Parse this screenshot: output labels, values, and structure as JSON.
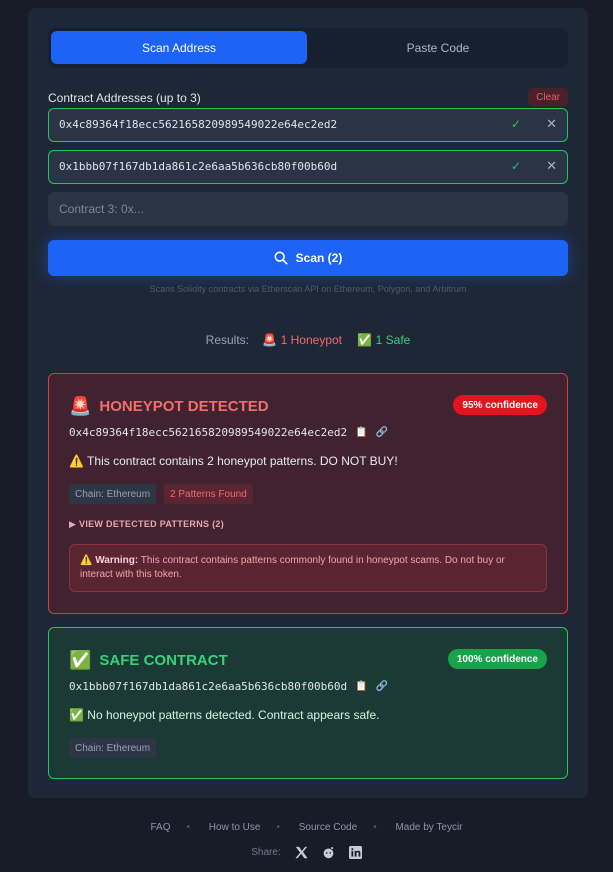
{
  "tabs": {
    "scan_address": "Scan Address",
    "paste_code": "Paste Code"
  },
  "form": {
    "label": "Contract Addresses (up to 3)",
    "clear": "Clear",
    "address_1": "0x4c89364f18ecc562165820989549022e64ec2ed2",
    "address_2": "0x1bbb07f167db1da861c2e6aa5b636cb80f00b60d",
    "address_3_placeholder": "Contract 3: 0x...",
    "scan_label": "Scan (2)",
    "hint": "Scans Solidity contracts via Etherscan API on Ethereum, Polygon, and Arbitrum"
  },
  "results": {
    "label": "Results:",
    "honeypot": "🚨 1 Honeypot",
    "safe": "✅ 1 Safe"
  },
  "cards": {
    "honeypot": {
      "title": "HONEYPOT DETECTED",
      "confidence": "95% confidence",
      "address": "0x4c89364f18ecc562165820989549022e64ec2ed2",
      "message": "⚠️ This contract contains 2 honeypot patterns. DO NOT BUY!",
      "chain": "Chain: Ethereum",
      "patterns_found": "2 Patterns Found",
      "view_patterns": "▶  VIEW DETECTED PATTERNS (2)",
      "warning_title": "⚠️ Warning:",
      "warning_text": "This contract contains patterns commonly found in honeypot scams. Do not buy or interact with this token."
    },
    "safe": {
      "title": "SAFE CONTRACT",
      "confidence": "100% confidence",
      "address": "0x1bbb07f167db1da861c2e6aa5b636cb80f00b60d",
      "message": "✅ No honeypot patterns detected. Contract appears safe.",
      "chain": "Chain: Ethereum"
    }
  },
  "footer": {
    "links": [
      "FAQ",
      "How to Use",
      "Source Code",
      "Made by Teycir"
    ],
    "share_label": "Share:"
  },
  "colors": {
    "accent": "#1d63f5",
    "danger": "#e2151f",
    "success": "#16a34a"
  }
}
